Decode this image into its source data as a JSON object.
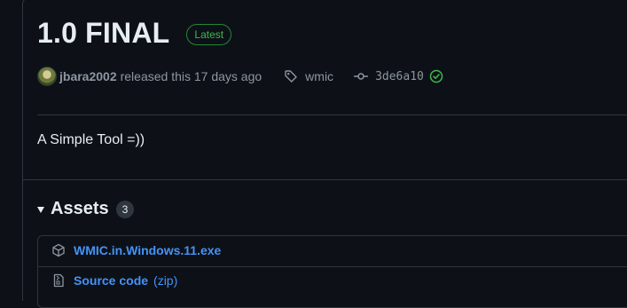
{
  "release": {
    "title": "1.0 FINAL",
    "badge": "Latest",
    "author": "jbara2002",
    "released_text": "released this 17 days ago",
    "tag": "wmic",
    "commit": "3de6a10",
    "description": "A Simple Tool =))"
  },
  "assets": {
    "title": "Assets",
    "count": "3",
    "items": [
      {
        "name": "WMIC.in.Windows.11.exe",
        "ext": "",
        "icon": "package-icon"
      },
      {
        "name": "Source code",
        "ext": "(zip)",
        "icon": "file-zip-icon"
      }
    ]
  },
  "colors": {
    "background": "#0d1117",
    "link": "#4493f8",
    "badge_green": "#3fb950",
    "border": "#30363d",
    "muted": "#8d96a0"
  }
}
